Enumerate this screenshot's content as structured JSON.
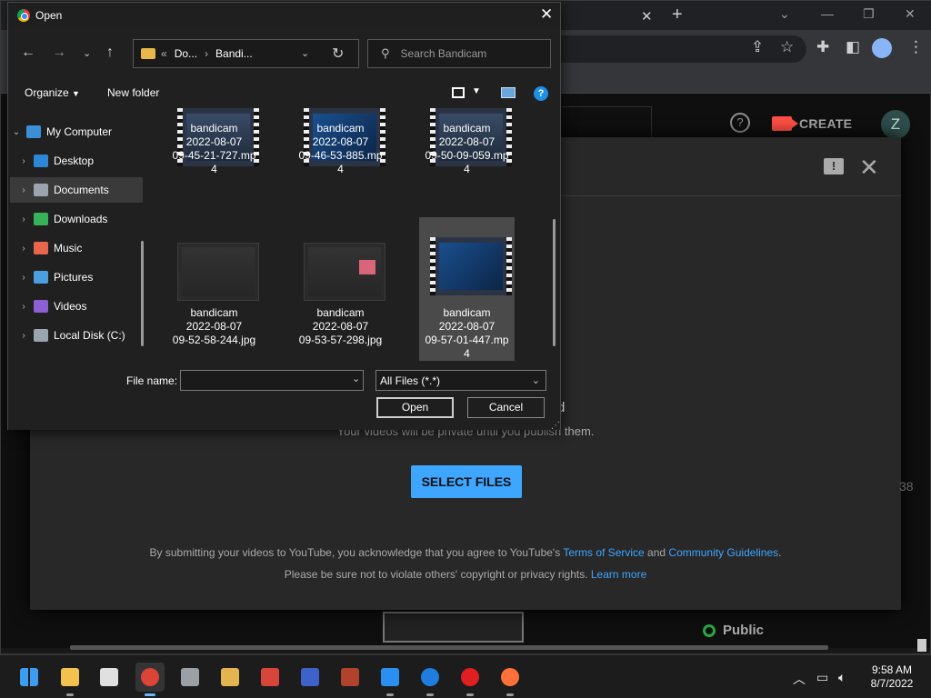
{
  "dialog": {
    "title": "Open",
    "address": {
      "crumb_1": "Do...",
      "crumb_2": "Bandi..."
    },
    "search_placeholder": "Search Bandicam",
    "commands": {
      "organize": "Organize",
      "new_folder": "New folder"
    },
    "tree": [
      {
        "label": "My Computer",
        "icon": "computer-icon",
        "color": "#3c8fd6",
        "expanded": true,
        "selected": false
      },
      {
        "label": "Desktop",
        "icon": "desktop-icon",
        "color": "#2d87d8",
        "selected": false
      },
      {
        "label": "Documents",
        "icon": "documents-icon",
        "color": "#9aa5b0",
        "selected": true
      },
      {
        "label": "Downloads",
        "icon": "downloads-icon",
        "color": "#38b25a",
        "selected": false
      },
      {
        "label": "Music",
        "icon": "music-icon",
        "color": "#e8664c",
        "selected": false
      },
      {
        "label": "Pictures",
        "icon": "pictures-icon",
        "color": "#4b9ee0",
        "selected": false
      },
      {
        "label": "Videos",
        "icon": "videos-icon",
        "color": "#8c5fd3",
        "selected": false
      },
      {
        "label": "Local Disk (C:)",
        "icon": "drive-icon",
        "color": "#9aa5b0",
        "selected": false
      }
    ],
    "files": [
      {
        "line1": "bandicam",
        "line2": "2022-08-07",
        "line3": "09-45-21-727.mp",
        "line4": "4",
        "kind": "video"
      },
      {
        "line1": "bandicam",
        "line2": "2022-08-07",
        "line3": "09-46-53-885.mp",
        "line4": "4",
        "kind": "video"
      },
      {
        "line1": "bandicam",
        "line2": "2022-08-07",
        "line3": "09-50-09-059.mp",
        "line4": "4",
        "kind": "video"
      },
      {
        "line1": "bandicam",
        "line2": "2022-08-07",
        "line3": "09-52-58-244.jpg",
        "line4": "",
        "kind": "image"
      },
      {
        "line1": "bandicam",
        "line2": "2022-08-07",
        "line3": "09-53-57-298.jpg",
        "line4": "",
        "kind": "image"
      },
      {
        "line1": "bandicam",
        "line2": "2022-08-07",
        "line3": "09-57-01-447.mp",
        "line4": "4",
        "kind": "video",
        "selected": true
      }
    ],
    "footer": {
      "file_name_label": "File name:",
      "file_name_value": "",
      "file_type": "All Files (*.*)",
      "open_label": "Open",
      "cancel_label": "Cancel"
    }
  },
  "youtube": {
    "create_label": "CREATE",
    "user_initial": "Z",
    "drag_title_tail": "d",
    "subtitle": "Your videos will be private until you publish them.",
    "select_files_label": "SELECT FILES",
    "legal_1_pre": "By submitting your videos to YouTube, you acknowledge that you agree to YouTube's ",
    "legal_1_link1": "Terms of Service",
    "legal_1_mid": " and ",
    "legal_1_link2": "Community Guidelines",
    "legal_1_post": ".",
    "legal_2_pre": "Please be sure not to violate others' copyright or privacy rights. ",
    "legal_2_link": "Learn more",
    "right_edge_num": "38",
    "public_label": "Public",
    "accent": "#3ea6ff"
  },
  "taskbar": {
    "apps": [
      {
        "name": "start-icon",
        "color": "#3b9cf0"
      },
      {
        "name": "file-explorer-icon",
        "color": "#f2c14e"
      },
      {
        "name": "store-icon",
        "color": "#e0e0e0"
      },
      {
        "name": "chrome-icon",
        "color": "#db4437",
        "active": true
      },
      {
        "name": "raccoon-app-icon",
        "color": "#9aa0a6"
      },
      {
        "name": "keys-app-icon",
        "color": "#e3b44f"
      },
      {
        "name": "hat-app-icon",
        "color": "#d8453a"
      },
      {
        "name": "floppy-save-icon",
        "color": "#3d62c9"
      },
      {
        "name": "winrar-icon",
        "color": "#b0422e"
      },
      {
        "name": "media-player-icon",
        "color": "#2a8ff0"
      },
      {
        "name": "teamviewer-icon",
        "color": "#1f7de0"
      },
      {
        "name": "record-icon",
        "color": "#e02020"
      },
      {
        "name": "firefox-icon",
        "color": "#ff7139"
      }
    ],
    "time": "9:58 AM",
    "date": "8/7/2022"
  }
}
